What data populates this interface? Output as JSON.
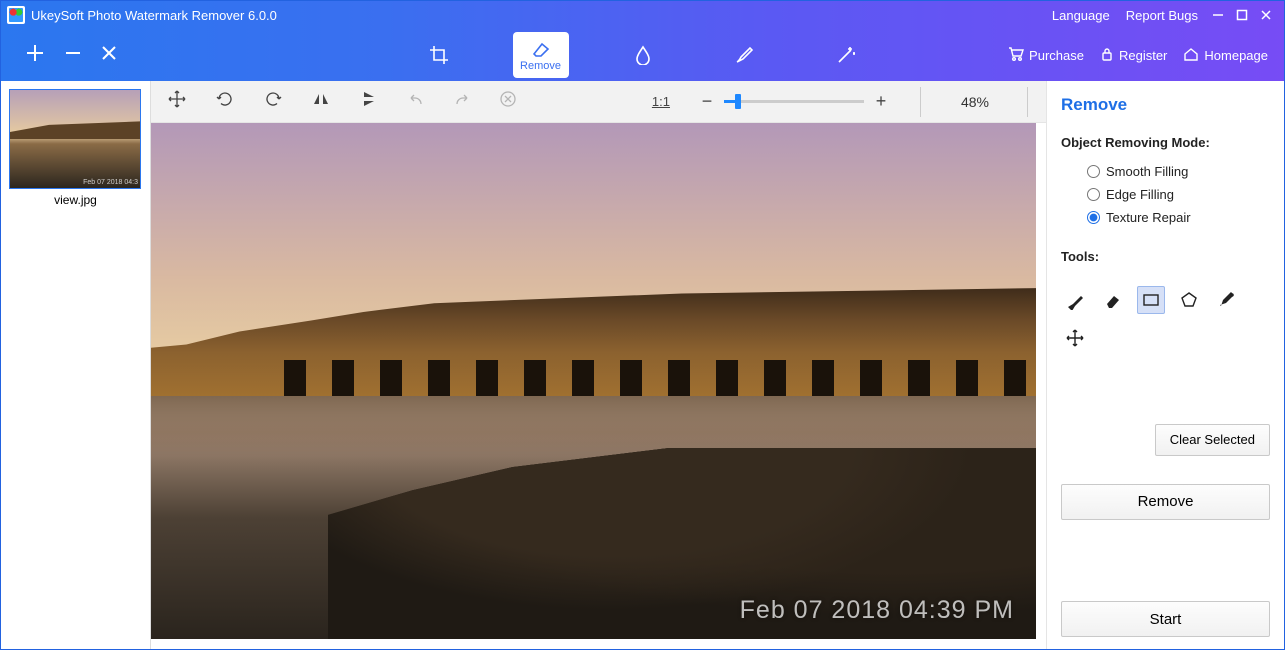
{
  "title": "UkeySoft Photo Watermark Remover 6.0.0",
  "titlebar_links": {
    "language": "Language",
    "report": "Report Bugs"
  },
  "toolbar": {
    "modes": {
      "crop": "",
      "remove": "Remove",
      "drop": "",
      "retouch": "",
      "magic": ""
    },
    "links": {
      "purchase": "Purchase",
      "register": "Register",
      "homepage": "Homepage"
    }
  },
  "thumb": {
    "filename": "view.jpg",
    "stamp": "Feb 07 2018 04:3"
  },
  "preview": {
    "zoom_label": "1:1",
    "zoom_percent": "48%",
    "watermark": "Feb 07 2018 04:39 PM"
  },
  "panel": {
    "title": "Remove",
    "mode_section": "Object Removing Mode:",
    "modes": {
      "smooth": "Smooth Filling",
      "edge": "Edge Filling",
      "texture": "Texture Repair"
    },
    "tools_section": "Tools:",
    "clear": "Clear Selected",
    "remove": "Remove",
    "start": "Start"
  }
}
